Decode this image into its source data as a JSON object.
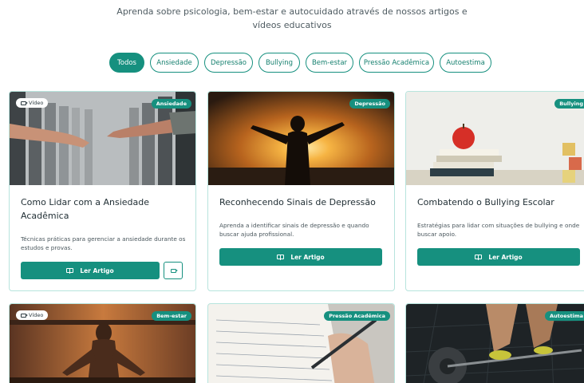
{
  "header": {
    "subtitle": "Aprenda sobre psicologia, bem-estar e autocuidado através de nossos artigos e vídeos educativos"
  },
  "filters": [
    "Todos",
    "Ansiedade",
    "Depressão",
    "Bullying",
    "Bem-estar",
    "Pressão Acadêmica",
    "Autoestima"
  ],
  "colors": {
    "accent": "#16907f",
    "card_border": "#b7e4dd"
  },
  "cards": [
    {
      "category": "Ansiedade",
      "video_badge": "Vídeo",
      "title": "Como Lidar com a Ansiedade Acadêmica",
      "description": "Técnicas práticas para gerenciar a ansiedade durante os estudos e provas.",
      "button_label": "Ler Artigo",
      "icon": "book-icon"
    },
    {
      "category": "Depressão",
      "title": "Reconhecendo Sinais de Depressão",
      "description": "Aprenda a identificar sinais de depressão e quando buscar ajuda profissional.",
      "button_label": "Ler Artigo",
      "icon": "book-icon"
    },
    {
      "category": "Bullying",
      "title": "Combatendo o Bullying Escolar",
      "description": "Estratégias para lidar com situações de bullying e onde buscar apoio.",
      "button_label": "Ler Artigo",
      "icon": "book-icon"
    },
    {
      "category": "Bem-estar",
      "video_badge": "Vídeo"
    },
    {
      "category": "Pressão Acadêmica"
    },
    {
      "category": "Autoestima"
    }
  ]
}
